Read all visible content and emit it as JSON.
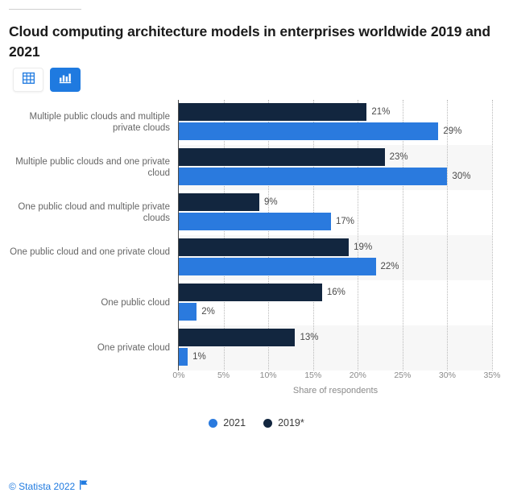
{
  "header": {
    "title": "Cloud computing architecture models in enterprises worldwide 2019 and 2021"
  },
  "toolbar": {
    "table_view_label": "table-view",
    "chart_view_label": "chart-view",
    "table_icon": "table-icon",
    "chart_icon": "bar-chart-icon",
    "active": "chart-view"
  },
  "footer": {
    "copyright": "© Statista 2022",
    "flag_icon": "flag-icon"
  },
  "colors": {
    "series_2021": "#2a7ade",
    "series_2019": "#12263f",
    "accent": "#1f7ae0",
    "band": "#f7f7f7"
  },
  "chart_data": {
    "type": "bar",
    "orientation": "horizontal",
    "title": "Cloud computing architecture models in enterprises worldwide 2019 and 2021",
    "xlabel": "Share of respondents",
    "ylabel": "",
    "xlim": [
      0,
      35
    ],
    "xticks": [
      0,
      5,
      10,
      15,
      20,
      25,
      30,
      35
    ],
    "xtick_labels": [
      "0%",
      "5%",
      "10%",
      "15%",
      "20%",
      "25%",
      "30%",
      "35%"
    ],
    "grid": true,
    "legend_position": "bottom",
    "categories": [
      "Multiple public clouds and multiple private clouds",
      "Multiple public clouds and one private cloud",
      "One public cloud and multiple private clouds",
      "One public cloud and one private cloud",
      "One public cloud",
      "One private cloud"
    ],
    "series": [
      {
        "name": "2019*",
        "color": "#12263f",
        "values": [
          21,
          23,
          9,
          19,
          16,
          13
        ],
        "labels": [
          "21%",
          "23%",
          "9%",
          "19%",
          "16%",
          "13%"
        ]
      },
      {
        "name": "2021",
        "color": "#2a7ade",
        "values": [
          29,
          30,
          17,
          22,
          2,
          1
        ],
        "labels": [
          "29%",
          "30%",
          "17%",
          "22%",
          "2%",
          "1%"
        ]
      }
    ],
    "legend": [
      "2021",
      "2019*"
    ]
  }
}
